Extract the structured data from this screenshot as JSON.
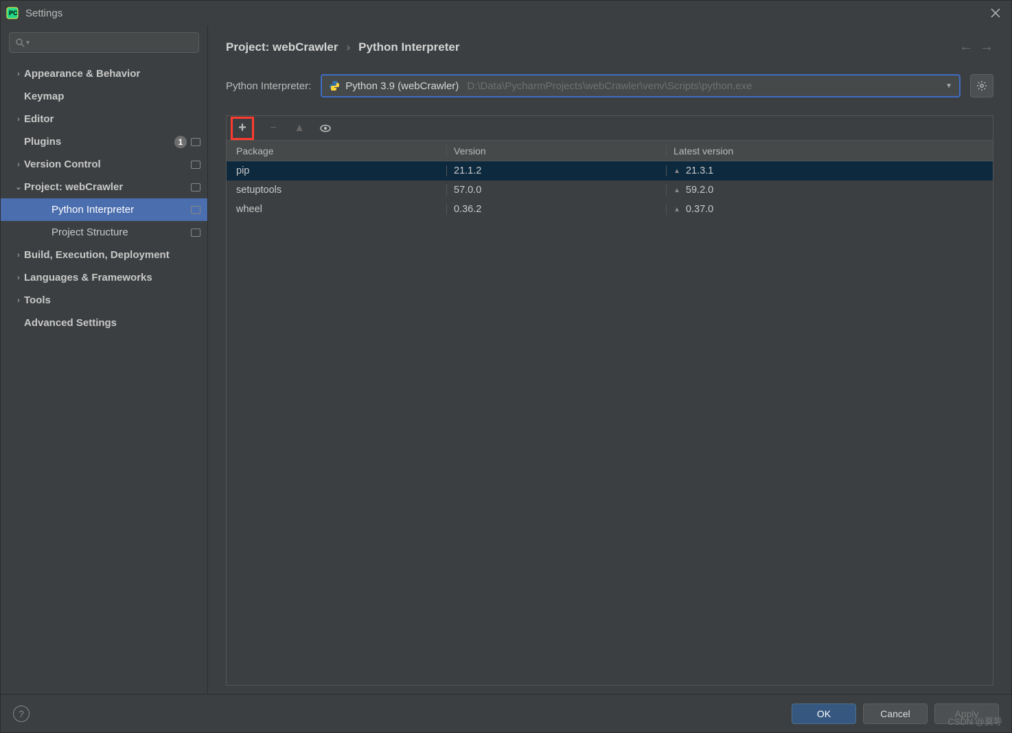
{
  "window": {
    "title": "Settings"
  },
  "breadcrumb": {
    "project": "Project: webCrawler",
    "page": "Python Interpreter"
  },
  "sidebar": {
    "items": [
      {
        "label": "Appearance & Behavior",
        "expandable": true,
        "expanded": false,
        "level": 1,
        "bold": true
      },
      {
        "label": "Keymap",
        "expandable": false,
        "level": 1,
        "bold": true
      },
      {
        "label": "Editor",
        "expandable": true,
        "expanded": false,
        "level": 1,
        "bold": true
      },
      {
        "label": "Plugins",
        "expandable": false,
        "level": 1,
        "bold": true,
        "badge": "1",
        "proj": true
      },
      {
        "label": "Version Control",
        "expandable": true,
        "expanded": false,
        "level": 1,
        "bold": true,
        "proj": true
      },
      {
        "label": "Project: webCrawler",
        "expandable": true,
        "expanded": true,
        "level": 1,
        "bold": true,
        "proj": true
      },
      {
        "label": "Python Interpreter",
        "expandable": false,
        "level": 2,
        "selected": true,
        "proj": true
      },
      {
        "label": "Project Structure",
        "expandable": false,
        "level": 2,
        "proj": true
      },
      {
        "label": "Build, Execution, Deployment",
        "expandable": true,
        "expanded": false,
        "level": 1,
        "bold": true
      },
      {
        "label": "Languages & Frameworks",
        "expandable": true,
        "expanded": false,
        "level": 1,
        "bold": true
      },
      {
        "label": "Tools",
        "expandable": true,
        "expanded": false,
        "level": 1,
        "bold": true
      },
      {
        "label": "Advanced Settings",
        "expandable": false,
        "level": 1,
        "bold": true
      }
    ]
  },
  "interpreter": {
    "label": "Python Interpreter:",
    "name": "Python 3.9 (webCrawler)",
    "path": "D:\\Data\\PycharmProjects\\webCrawler\\venv\\Scripts\\python.exe"
  },
  "table": {
    "headers": {
      "package": "Package",
      "version": "Version",
      "latest": "Latest version"
    },
    "rows": [
      {
        "pkg": "pip",
        "ver": "21.1.2",
        "latest": "21.3.1",
        "upgrade": true,
        "selected": true
      },
      {
        "pkg": "setuptools",
        "ver": "57.0.0",
        "latest": "59.2.0",
        "upgrade": true
      },
      {
        "pkg": "wheel",
        "ver": "0.36.2",
        "latest": "0.37.0",
        "upgrade": true
      }
    ]
  },
  "footer": {
    "ok": "OK",
    "cancel": "Cancel",
    "apply": "Apply"
  },
  "watermark": "CSDN @莫导"
}
